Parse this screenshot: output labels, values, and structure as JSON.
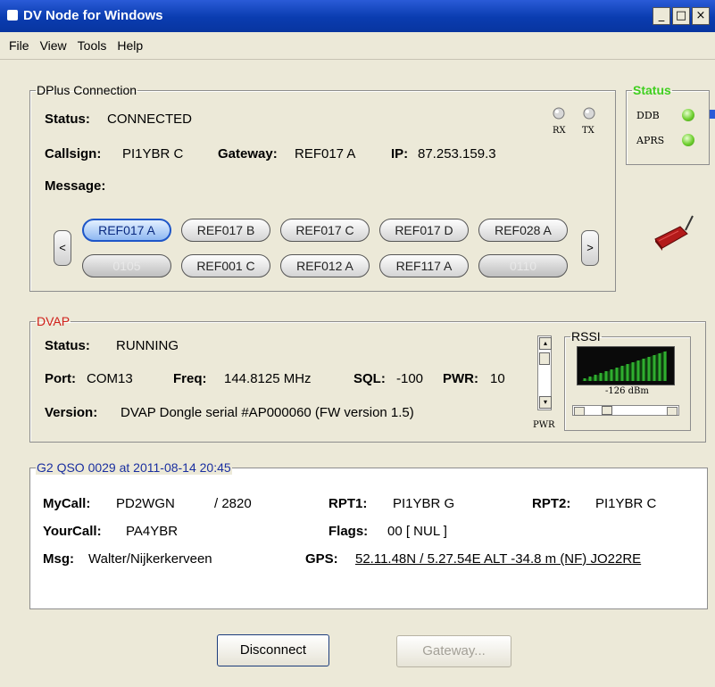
{
  "window": {
    "title": "DV Node for Windows",
    "controls": [
      "_",
      "□",
      "×"
    ]
  },
  "menu": [
    "File",
    "View",
    "Tools",
    "Help"
  ],
  "dplus": {
    "legend": "DPlus Connection",
    "status_label": "Status:",
    "status_value": "CONNECTED",
    "callsign_label": "Callsign:",
    "callsign_value": "PI1YBR C",
    "gateway_label": "Gateway:",
    "gateway_value": "REF017 A",
    "ip_label": "IP:",
    "ip_value": "87.253.159.3",
    "message_label": "Message:",
    "rx_label": "RX",
    "tx_label": "TX",
    "reflectors_row1": [
      "REF017 A",
      "REF017 B",
      "REF017 C",
      "REF017 D",
      "REF028 A"
    ],
    "reflectors_row2": [
      "0105",
      "REF001 C",
      "REF012 A",
      "REF117 A",
      "0110"
    ],
    "prev_arrow": "<",
    "next_arrow": ">"
  },
  "status_box": {
    "legend": "Status",
    "ddb_label": "DDB",
    "aprs_label": "APRS",
    "accent": "#3fcf1f"
  },
  "dvap": {
    "legend": "DVAP",
    "status_label": "Status:",
    "status_value": "RUNNING",
    "port_label": "Port:",
    "port_value": "COM13",
    "freq_label": "Freq:",
    "freq_value": "144.8125 MHz",
    "sql_label": "SQL:",
    "sql_value": "-100",
    "pwr_label": "PWR:",
    "pwr_value": "10",
    "version_label": "Version:",
    "version_value": "DVAP Dongle serial #AP000060 (FW version 1.5)",
    "pwr_slider_label": "PWR",
    "rssi_legend": "RSSI",
    "rssi_value": "-126 dBm",
    "legend_color": "#d0201a"
  },
  "qso": {
    "legend": "G2 QSO 0029 at 2011-08-14 20:45",
    "legend_color": "#1a2fa0",
    "mycall_label": "MyCall:",
    "mycall_value": "PD2WGN",
    "mycall_suffix": "/ 2820",
    "rpt1_label": "RPT1:",
    "rpt1_value": "PI1YBR G",
    "rpt2_label": "RPT2:",
    "rpt2_value": "PI1YBR C",
    "yourcall_label": "YourCall:",
    "yourcall_value": "PA4YBR",
    "flags_label": "Flags:",
    "flags_value": "00 [ NUL ]",
    "msg_label": "Msg:",
    "msg_value": "Walter/Nijkerkerveen",
    "gps_label": "GPS:",
    "gps_value": "52.11.48N / 5.27.54E  ALT -34.8 m (NF) JO22RE"
  },
  "buttons": {
    "disconnect": "Disconnect",
    "gateway": "Gateway..."
  }
}
